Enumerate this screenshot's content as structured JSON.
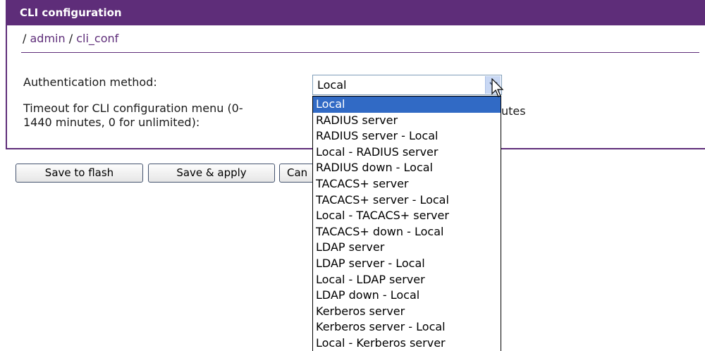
{
  "header": {
    "title": "CLI configuration"
  },
  "breadcrumb": {
    "sep": "/",
    "items": [
      "admin",
      "cli_conf"
    ]
  },
  "form": {
    "auth_label": "Authentication method:",
    "timeout_label_line1": "Timeout for CLI configuration menu (0-",
    "timeout_label_line2": "1440 minutes, 0 for unlimited):",
    "minutes_suffix": "utes",
    "auth_selected": "Local",
    "auth_options": [
      "Local",
      "RADIUS server",
      "RADIUS server - Local",
      "Local - RADIUS server",
      "RADIUS down - Local",
      "TACACS+ server",
      "TACACS+ server - Local",
      "Local - TACACS+ server",
      "TACACS+ down - Local",
      "LDAP server",
      "LDAP server - Local",
      "Local - LDAP server",
      "LDAP down - Local",
      "Kerberos server",
      "Kerberos server - Local",
      "Local - Kerberos server"
    ]
  },
  "buttons": {
    "save_flash": "Save to flash",
    "save_apply": "Save & apply",
    "cancel": "Can"
  },
  "colors": {
    "brand": "#5e2d79",
    "selection": "#316ac5"
  }
}
